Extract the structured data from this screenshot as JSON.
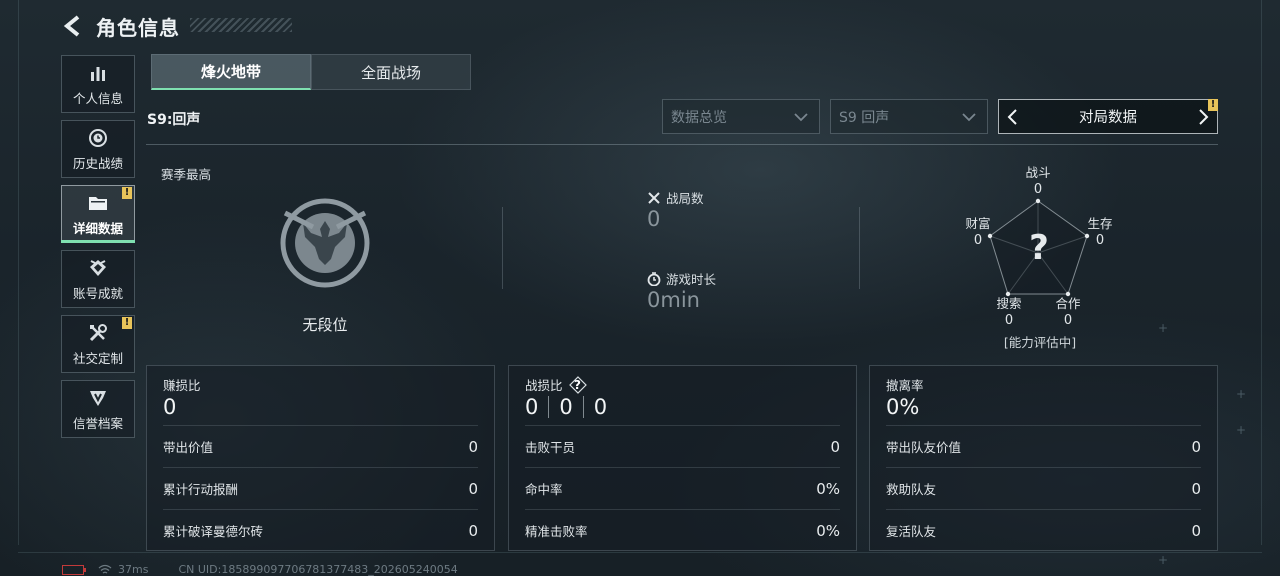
{
  "header": {
    "title": "角色信息"
  },
  "sidebar": {
    "items": [
      {
        "label": "个人信息",
        "icon": "bar-chart-icon"
      },
      {
        "label": "历史战绩",
        "icon": "history-clock-icon"
      },
      {
        "label": "详细数据",
        "icon": "folder-icon",
        "badge": "!"
      },
      {
        "label": "账号成就",
        "icon": "achievement-icon"
      },
      {
        "label": "社交定制",
        "icon": "tools-icon",
        "badge": "!"
      },
      {
        "label": "信誉档案",
        "icon": "shield-emblem-icon"
      }
    ],
    "active_index": 2
  },
  "tabs": [
    {
      "label": "烽火地带"
    },
    {
      "label": "全面战场"
    }
  ],
  "season_label": "S9:回声",
  "filters": {
    "overview": "数据总览",
    "season": "S9 回声",
    "pager_label": "对局数据",
    "pager_badge": "!"
  },
  "rank": {
    "label": "赛季最高",
    "name": "无段位"
  },
  "summary": {
    "matches_label": "战局数",
    "matches_value": "0",
    "playtime_label": "游戏时长",
    "playtime_value": "0min"
  },
  "radar": {
    "center": "?",
    "axes": [
      {
        "label": "战斗",
        "value": "0"
      },
      {
        "label": "生存",
        "value": "0"
      },
      {
        "label": "合作",
        "value": "0"
      },
      {
        "label": "搜索",
        "value": "0"
      },
      {
        "label": "财富",
        "value": "0"
      }
    ],
    "status": "[能力评估中]"
  },
  "cards": [
    {
      "title": "赚损比",
      "value": "0",
      "rows": [
        {
          "label": "带出价值",
          "value": "0"
        },
        {
          "label": "累计行动报酬",
          "value": "0"
        },
        {
          "label": "累计破译曼德尔砖",
          "value": "0"
        }
      ]
    },
    {
      "title": "战损比",
      "help": "?",
      "values": [
        "0",
        "0",
        "0"
      ],
      "rows": [
        {
          "label": "击败干员",
          "value": "0"
        },
        {
          "label": "命中率",
          "value": "0%"
        },
        {
          "label": "精准击败率",
          "value": "0%"
        }
      ]
    },
    {
      "title": "撤离率",
      "value": "0%",
      "rows": [
        {
          "label": "带出队友价值",
          "value": "0"
        },
        {
          "label": "救助队友",
          "value": "0"
        },
        {
          "label": "复活队友",
          "value": "0"
        }
      ]
    }
  ],
  "footer": {
    "ping": "37ms",
    "uid": "CN UID:1858990977067813774​83_202605240054"
  },
  "colors": {
    "accent": "#7fe0b0",
    "badge": "#e8c45a",
    "battery_low": "#c23a3a"
  }
}
